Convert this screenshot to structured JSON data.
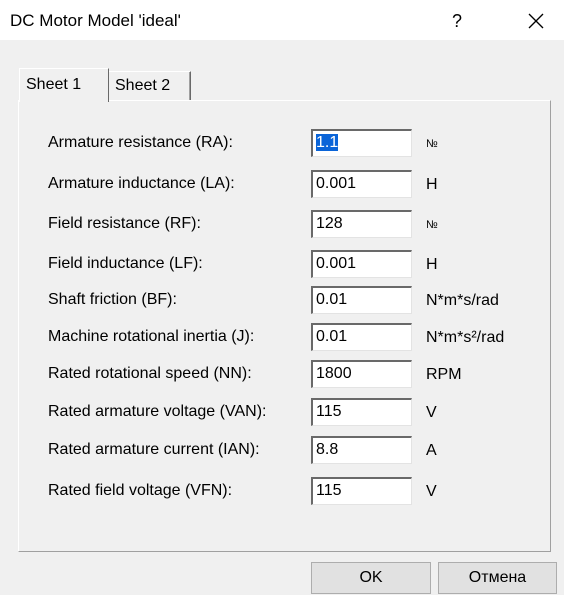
{
  "window": {
    "title": "DC Motor Model 'ideal'",
    "help_label": "?"
  },
  "tabs": [
    {
      "label": "Sheet 1",
      "active": true
    },
    {
      "label": "Sheet 2",
      "active": false
    }
  ],
  "fields": [
    {
      "label": "Armature resistance (RA):",
      "value": "1.1",
      "unit": "№",
      "selected": true
    },
    {
      "label": "Armature inductance (LA):",
      "value": "0.001",
      "unit": "H"
    },
    {
      "label": "Field resistance (RF):",
      "value": "128",
      "unit": "№"
    },
    {
      "label": "Field inductance (LF):",
      "value": "0.001",
      "unit": "H"
    },
    {
      "label": "Shaft friction (BF):",
      "value": "0.01",
      "unit": "N*m*s/rad"
    },
    {
      "label": "Machine rotational inertia (J):",
      "value": "0.01",
      "unit": "N*m*s²/rad"
    },
    {
      "label": "Rated rotational speed (NN):",
      "value": "1800",
      "unit": "RPM"
    },
    {
      "label": "Rated armature voltage (VAN):",
      "value": "115",
      "unit": "V"
    },
    {
      "label": "Rated armature current (IAN):",
      "value": "8.8",
      "unit": "A"
    },
    {
      "label": "Rated field voltage (VFN):",
      "value": "115",
      "unit": "V"
    }
  ],
  "buttons": {
    "ok_label": "OK",
    "cancel_label": "Отмена"
  }
}
